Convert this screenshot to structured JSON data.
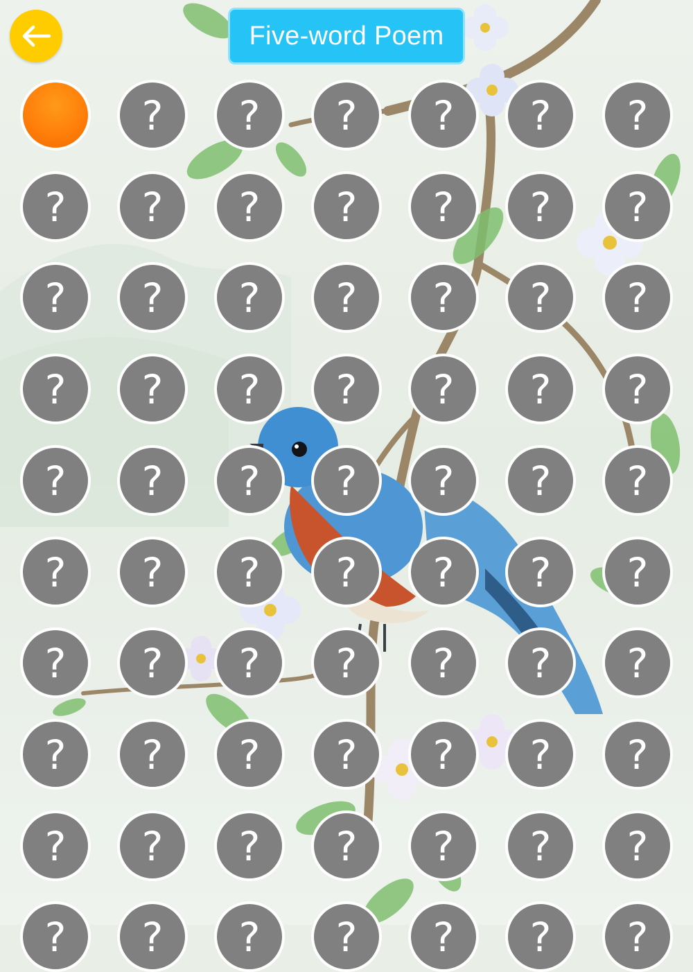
{
  "header": {
    "title": "Five-word Poem",
    "back_icon": "arrow-left-icon"
  },
  "grid": {
    "columns": 7,
    "rows": 10,
    "cell_symbol": "?",
    "current_level": 1,
    "locked_icon": "question-mark-icon"
  },
  "colors": {
    "back_button": "#ffcc00",
    "title_bg": "#26c4f6",
    "locked": "#808080",
    "current": "#ff7f0a"
  }
}
